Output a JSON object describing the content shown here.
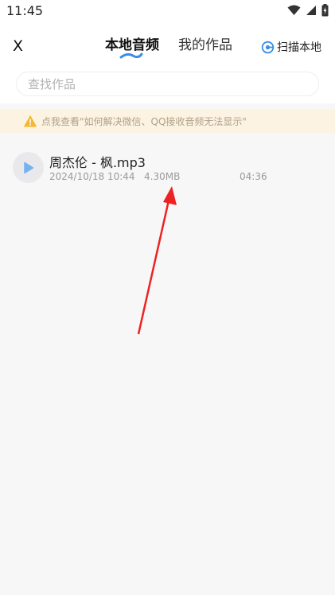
{
  "status_bar": {
    "time": "11:45",
    "icons": [
      "wifi-icon",
      "signal-icon",
      "battery-charging-icon"
    ]
  },
  "header": {
    "close_label": "X",
    "tabs": [
      {
        "label": "本地音频",
        "active": true
      },
      {
        "label": "我的作品",
        "active": false
      }
    ],
    "scan_label": "扫描本地",
    "scan_icon": "scan-icon"
  },
  "search": {
    "placeholder": "查找作品"
  },
  "notice": {
    "icon": "warning-icon",
    "text": "点我查看\"如何解决微信、QQ接收音频无法显示\""
  },
  "tracks": [
    {
      "title": "周杰伦 - 枫.mp3",
      "date": "2024/10/18 10:44",
      "size": "4.30MB",
      "duration": "04:36"
    }
  ],
  "colors": {
    "background": "#f7f7f8",
    "accent_blue": "#3a8ee6",
    "notice_bg": "#fcf3e2",
    "warning": "#f5b82e",
    "annotation_arrow": "#ee2222"
  }
}
